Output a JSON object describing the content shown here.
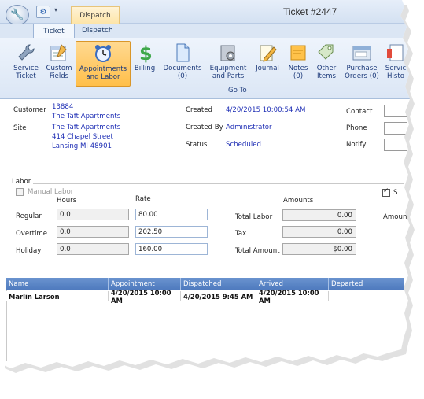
{
  "window": {
    "title": "Ticket #2447",
    "context_tab": "Dispatch"
  },
  "tabs": [
    {
      "label": "Ticket"
    },
    {
      "label": "Dispatch"
    }
  ],
  "ribbon": {
    "buttons": [
      {
        "label": "Service Ticket",
        "icon": "wrench-icon"
      },
      {
        "label": "Custom Fields",
        "icon": "custom-fields-icon"
      },
      {
        "label": "Appointments and Labor",
        "icon": "alarm-clock-icon"
      },
      {
        "label": "Billing",
        "icon": "dollar-icon"
      },
      {
        "label": "Documents (0)",
        "icon": "document-icon"
      },
      {
        "label": "Equipment and Parts",
        "icon": "equipment-icon"
      },
      {
        "label": "Journal",
        "icon": "journal-icon"
      },
      {
        "label": "Notes (0)",
        "icon": "note-icon"
      },
      {
        "label": "Other Items",
        "icon": "tag-icon"
      },
      {
        "label": "Purchase Orders (0)",
        "icon": "purchase-order-icon"
      },
      {
        "label": "Servic Histo",
        "icon": "history-icon"
      }
    ],
    "group_label": "Go To"
  },
  "ticket": {
    "customer_label": "Customer",
    "customer_id": "13884",
    "customer_name": "The Taft Apartments",
    "site_label": "Site",
    "site_name": "The Taft Apartments",
    "site_address1": "414 Chapel Street",
    "site_address2": "Lansing MI 48901",
    "created_label": "Created",
    "created_value": "4/20/2015 10:00:54 AM",
    "created_by_label": "Created By",
    "created_by_value": "Administrator",
    "status_label": "Status",
    "status_value": "Scheduled",
    "contact_label": "Contact",
    "phone_label": "Phone",
    "notify_label": "Notify"
  },
  "labor": {
    "section_title": "Labor",
    "manual_labor_label": "Manual Labor",
    "hours_header": "Hours",
    "rate_header": "Rate",
    "amounts_header": "Amounts",
    "rows": [
      {
        "label": "Regular",
        "hours": "0.0",
        "rate": "80.00"
      },
      {
        "label": "Overtime",
        "hours": "0.0",
        "rate": "202.50"
      },
      {
        "label": "Holiday",
        "hours": "0.0",
        "rate": "160.00"
      }
    ],
    "totals": [
      {
        "label": "Total Labor",
        "value": "0.00"
      },
      {
        "label": "Tax",
        "value": "0.00"
      },
      {
        "label": "Total Amount",
        "value": "$0.00"
      }
    ],
    "right_check_label": "S",
    "amount_label": "Amount"
  },
  "grid": {
    "columns": [
      "Name",
      "Appointment",
      "Dispatched",
      "Arrived",
      "Departed"
    ],
    "rows": [
      [
        "Marlin Larson",
        "4/20/2015 10:00 AM",
        "4/20/2015 9:45 AM",
        "4/20/2015 10:00 AM",
        ""
      ]
    ]
  }
}
